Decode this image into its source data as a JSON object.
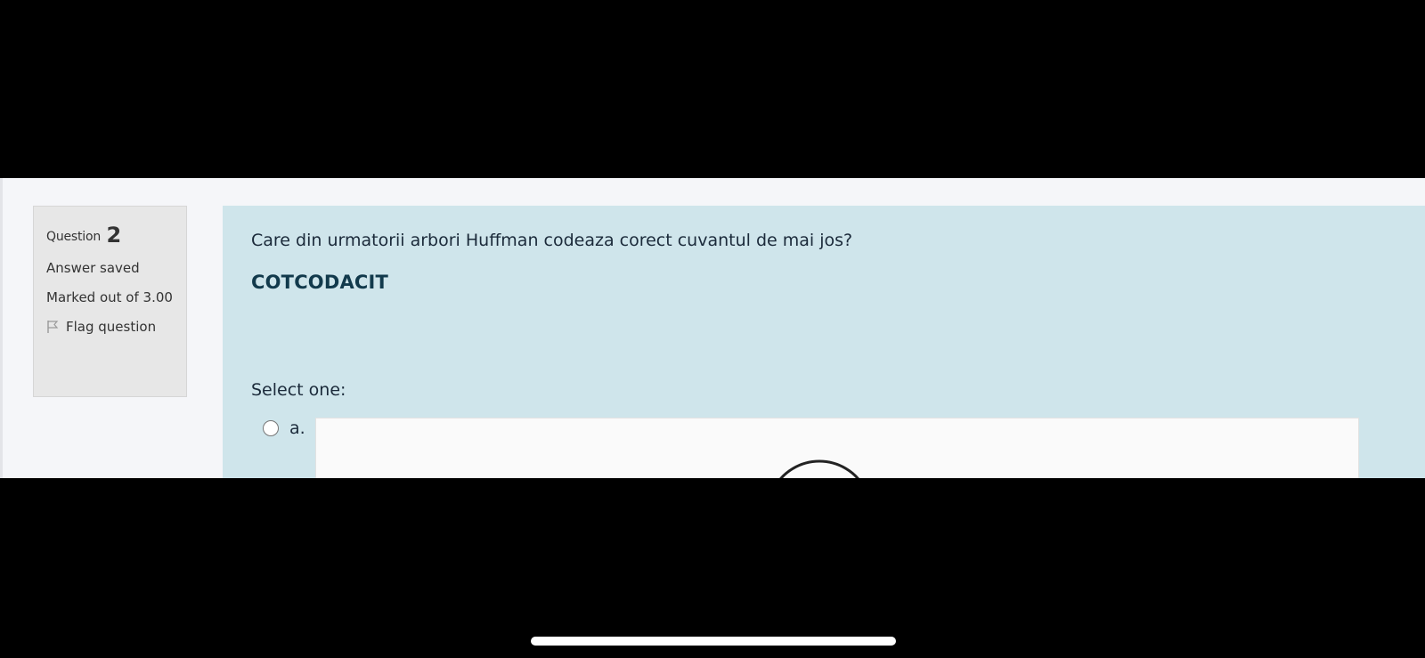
{
  "question": {
    "label": "Question",
    "number": "2",
    "state": "Answer saved",
    "grade": "Marked out of 3.00",
    "flag_label": "Flag question"
  },
  "content": {
    "text": "Care din urmatorii arbori Huffman codeaza corect cuvantul de mai jos?",
    "word": "COTCODACIT",
    "prompt": "Select one:",
    "options": [
      {
        "label": "a."
      }
    ]
  },
  "colors": {
    "info_bg": "#e7e7e7",
    "content_bg": "#cfe5eb",
    "word_color": "#123a4c"
  }
}
